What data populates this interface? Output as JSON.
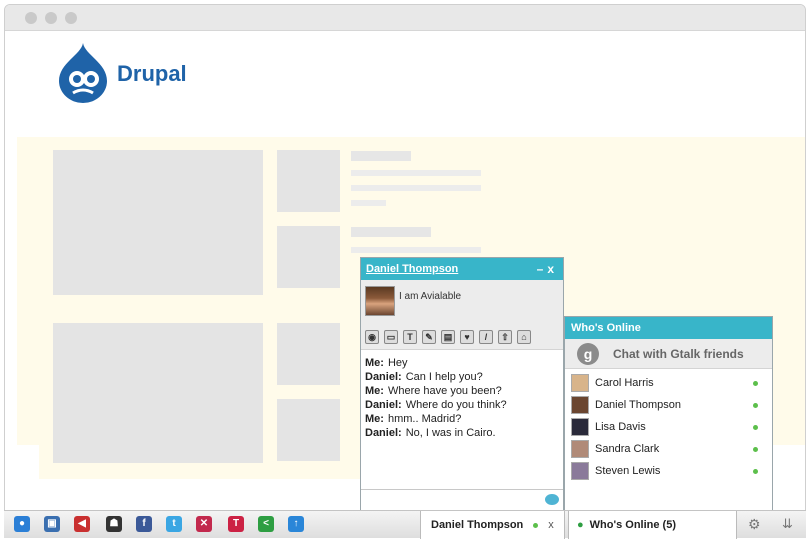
{
  "brand": {
    "name": "Drupal",
    "color": "#1f63a8"
  },
  "chat_window": {
    "contact_name": "Daniel Thompson",
    "status": "I am Avialable",
    "tools": [
      "webcam-icon",
      "screen-icon",
      "text-icon",
      "whiteboard-icon",
      "notes-icon",
      "cards-icon",
      "pencil-icon",
      "upload-icon",
      "broom-icon"
    ],
    "tool_glyphs": [
      "◉",
      "▭",
      "T",
      "✎",
      "▤",
      "♥",
      "/",
      "⇧",
      "⌂"
    ],
    "messages": [
      {
        "sender": "Me:",
        "text": "Hey"
      },
      {
        "sender": "Daniel:",
        "text": "Can I help you?"
      },
      {
        "sender": "Me:",
        "text": "Where have you been?"
      },
      {
        "sender": "Daniel:",
        "text": "Where do you think?"
      },
      {
        "sender": "Me:",
        "text": "hmm.. Madrid?"
      },
      {
        "sender": "Daniel:",
        "text": "No, I was in Cairo."
      }
    ]
  },
  "whos_online": {
    "title": "Who's Online",
    "gtalk_label": "Chat with Gtalk friends",
    "friends": [
      {
        "name": "Carol Harris",
        "avatar_color": "#d8b48a"
      },
      {
        "name": "Daniel Thompson",
        "avatar_color": "#6b4630"
      },
      {
        "name": "Lisa Davis",
        "avatar_color": "#2a2a3a"
      },
      {
        "name": "Sandra Clark",
        "avatar_color": "#b08a78"
      },
      {
        "name": "Steven Lewis",
        "avatar_color": "#8a7a9a"
      }
    ]
  },
  "toolbar": {
    "chat_tab_name": "Daniel Thompson",
    "close_label": "x",
    "whos_online_tab": "Who's Online (5)",
    "icons": [
      "globe-icon",
      "screen-share-icon",
      "megaphone-icon",
      "game-icon",
      "facebook-icon",
      "twitter-icon",
      "flickr-icon",
      "text-tool-icon",
      "share-icon",
      "upload-arrow-icon"
    ],
    "icon_glyphs": [
      "●",
      "▣",
      "◀",
      "☗",
      "f",
      "t",
      "✕",
      "T",
      "<",
      "↑"
    ],
    "icon_colors": [
      "#2b7fd6",
      "#3a6fb0",
      "#c93030",
      "#333333",
      "#3b5998",
      "#3aa6e3",
      "#c2294d",
      "#cc2244",
      "#2e9e42",
      "#2a86d8"
    ]
  },
  "colors": {
    "accent": "#38b5c9",
    "online": "#5cbf4b"
  }
}
